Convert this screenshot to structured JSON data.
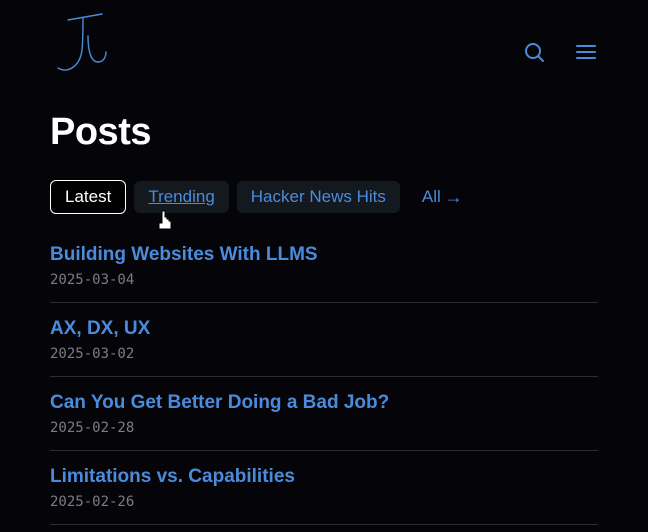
{
  "header": {
    "logo_label": "JM signature logo"
  },
  "page": {
    "title": "Posts"
  },
  "tabs": {
    "latest": "Latest",
    "trending": "Trending",
    "hackernews": "Hacker News Hits",
    "all": "All",
    "all_arrow": "→"
  },
  "posts": [
    {
      "title": "Building Websites With LLMS",
      "date": "2025-03-04"
    },
    {
      "title": "AX, DX, UX",
      "date": "2025-03-02"
    },
    {
      "title": "Can You Get Better Doing a Bad Job?",
      "date": "2025-02-28"
    },
    {
      "title": "Limitations vs. Capabilities",
      "date": "2025-02-26"
    }
  ],
  "colors": {
    "link": "#4a8cdb",
    "bg": "#050509",
    "muted": "#7a7d85"
  }
}
